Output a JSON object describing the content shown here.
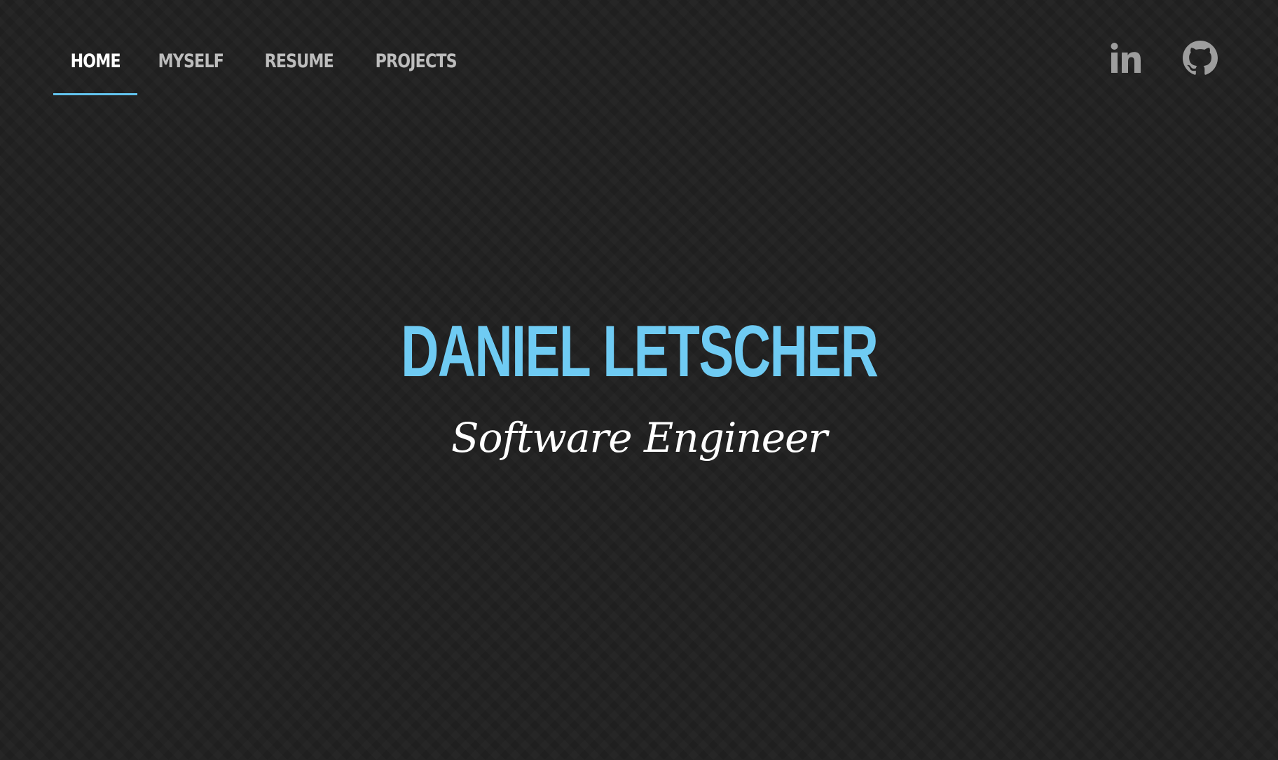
{
  "nav": {
    "items": [
      {
        "label": "HOME",
        "active": true
      },
      {
        "label": "MYSELF",
        "active": false
      },
      {
        "label": "RESUME",
        "active": false
      },
      {
        "label": "PROJECTS",
        "active": false
      }
    ]
  },
  "social": {
    "links": [
      {
        "icon": "linkedin-icon"
      },
      {
        "icon": "github-icon"
      }
    ]
  },
  "hero": {
    "name": "DANIEL LETSCHER",
    "title": "Software Engineer"
  },
  "colors": {
    "background": "#222222",
    "accent": "#62c3ee",
    "name": "#6fcbf3",
    "nav_inactive": "#bdbdbd",
    "nav_active": "#ffffff",
    "icon": "#9d9d9d"
  }
}
